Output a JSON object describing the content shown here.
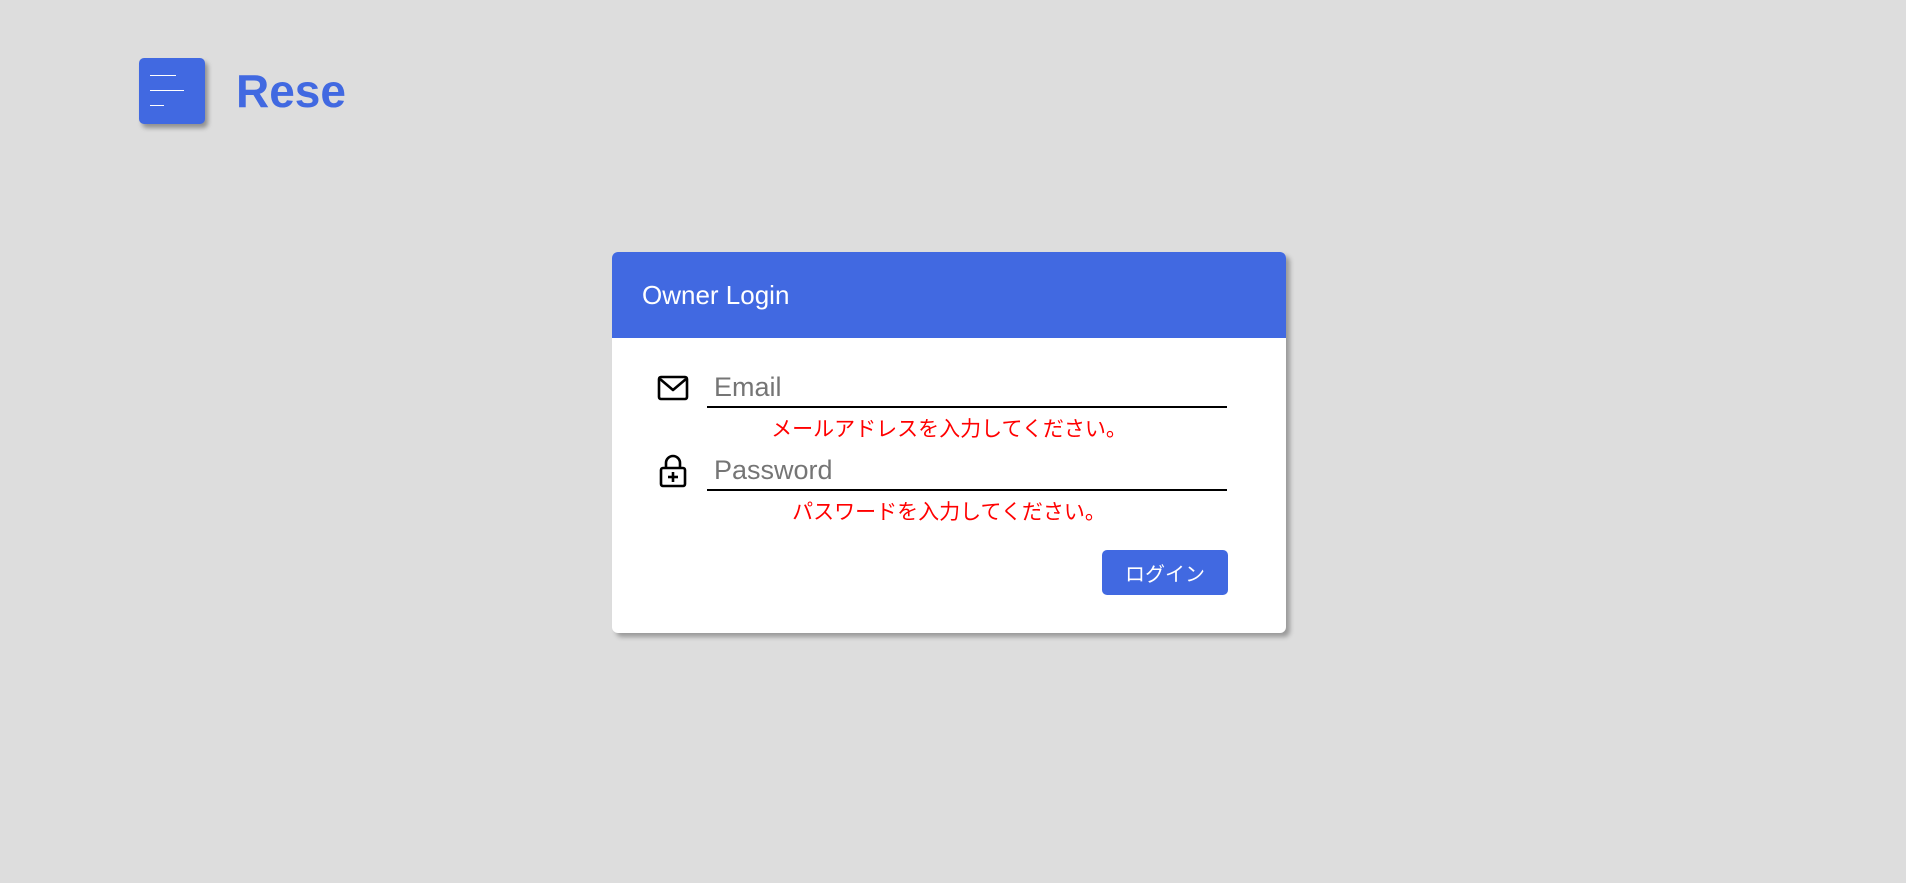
{
  "header": {
    "brand": "Rese",
    "menu_icon": "hamburger-menu-icon"
  },
  "login_card": {
    "title": "Owner Login",
    "email": {
      "icon": "envelope-icon",
      "placeholder": "Email",
      "value": "",
      "error": "メールアドレスを入力してください。"
    },
    "password": {
      "icon": "lock-icon",
      "placeholder": "Password",
      "value": "",
      "error": "パスワードを入力してください。"
    },
    "submit_label": "ログイン"
  },
  "colors": {
    "background": "#dddddd",
    "accent": "#4169e1",
    "error": "#ff0000",
    "card": "#ffffff"
  }
}
